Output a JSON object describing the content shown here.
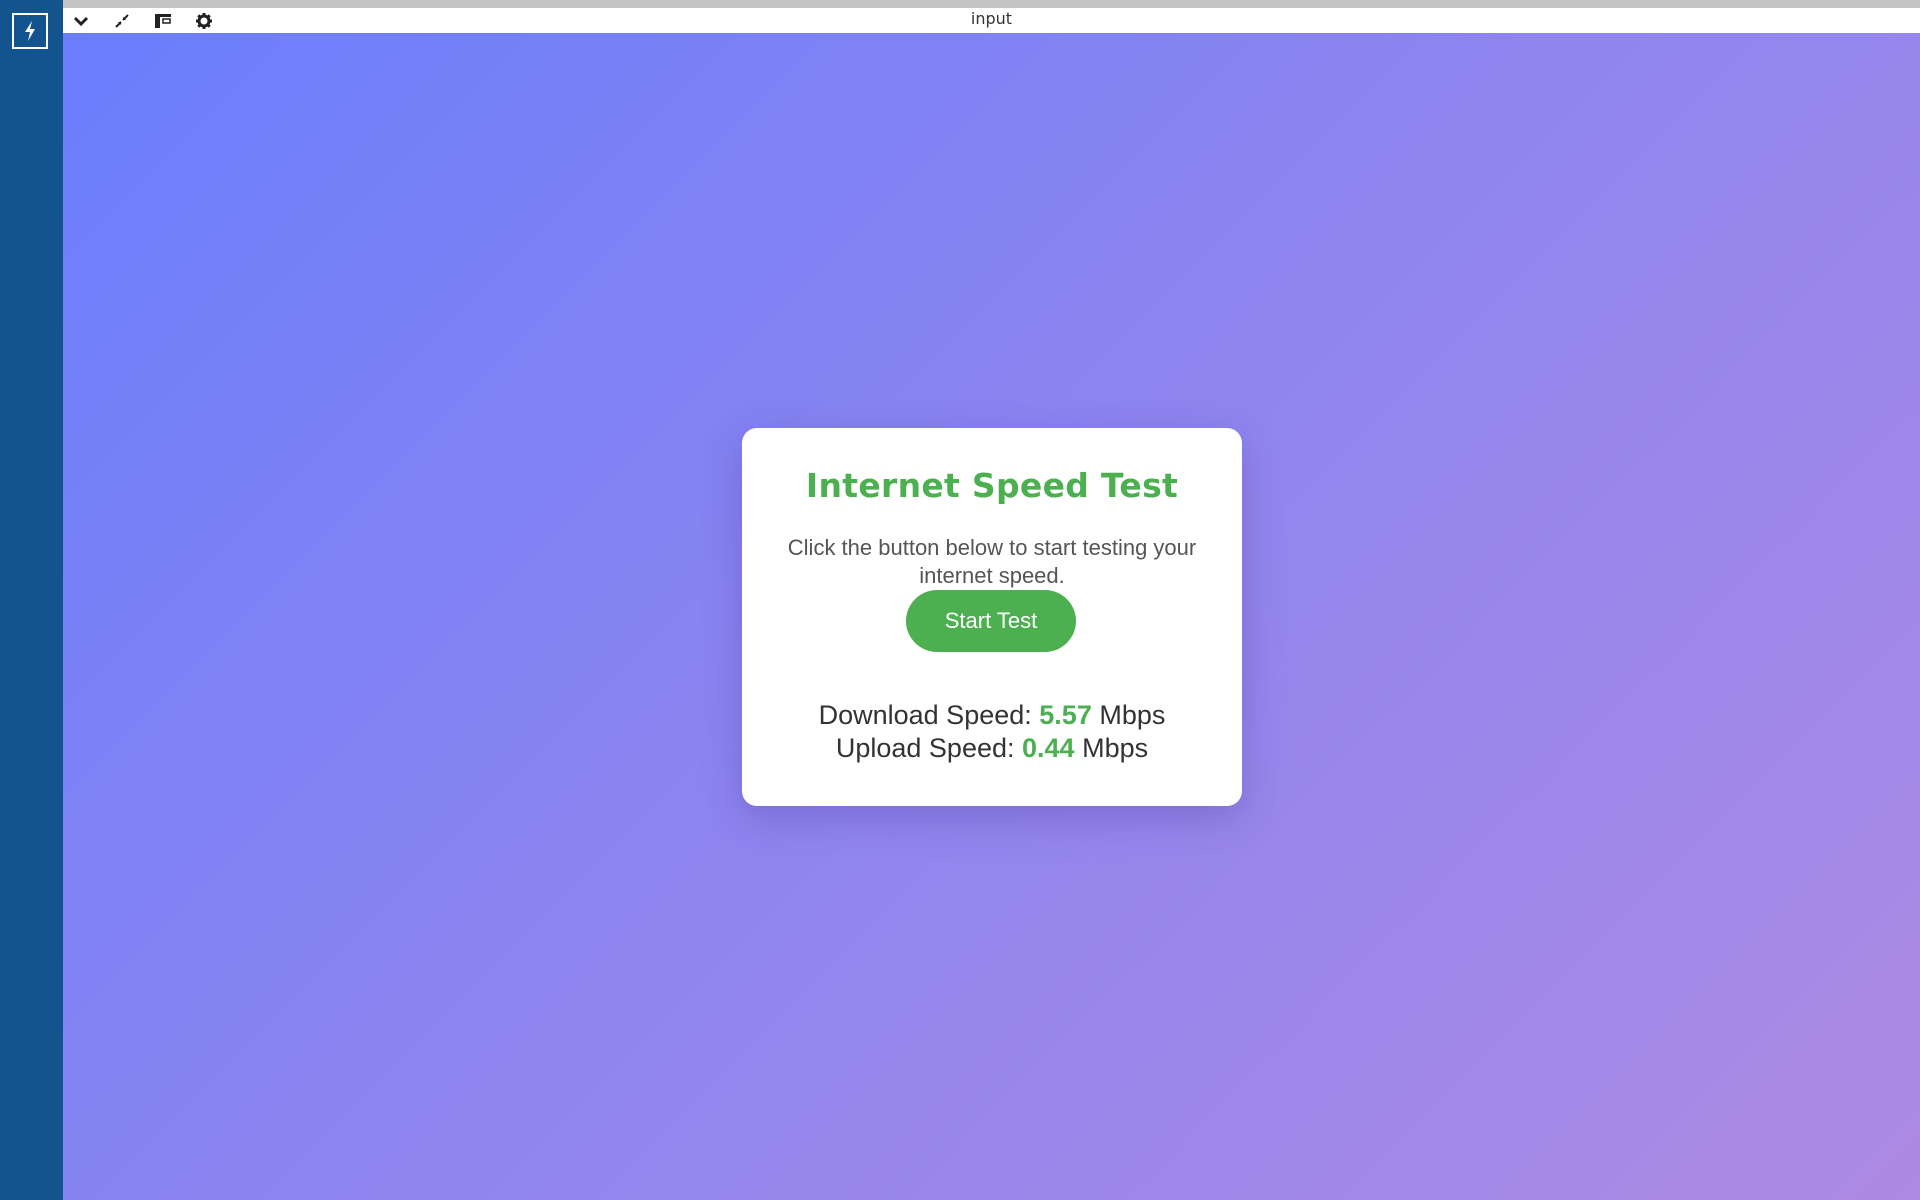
{
  "window": {
    "title": "input"
  },
  "toolbar": {
    "icons": [
      "chevron-down-icon",
      "compress-icon",
      "layout-icon",
      "gear-icon"
    ]
  },
  "sidebar": {
    "logo_icon": "lightning-bolt-icon",
    "color": "#13548f"
  },
  "card": {
    "title": "Internet Speed Test",
    "description": "Click the button below to start testing your internet speed.",
    "button_label": "Start Test",
    "download": {
      "label": "Download Speed:",
      "value": "5.57",
      "unit": "Mbps"
    },
    "upload": {
      "label": "Upload Speed:",
      "value": "0.44",
      "unit": "Mbps"
    }
  },
  "colors": {
    "accent": "#4caf50",
    "gradient_start": "#6a7efc",
    "gradient_end": "#ad8ae4"
  }
}
